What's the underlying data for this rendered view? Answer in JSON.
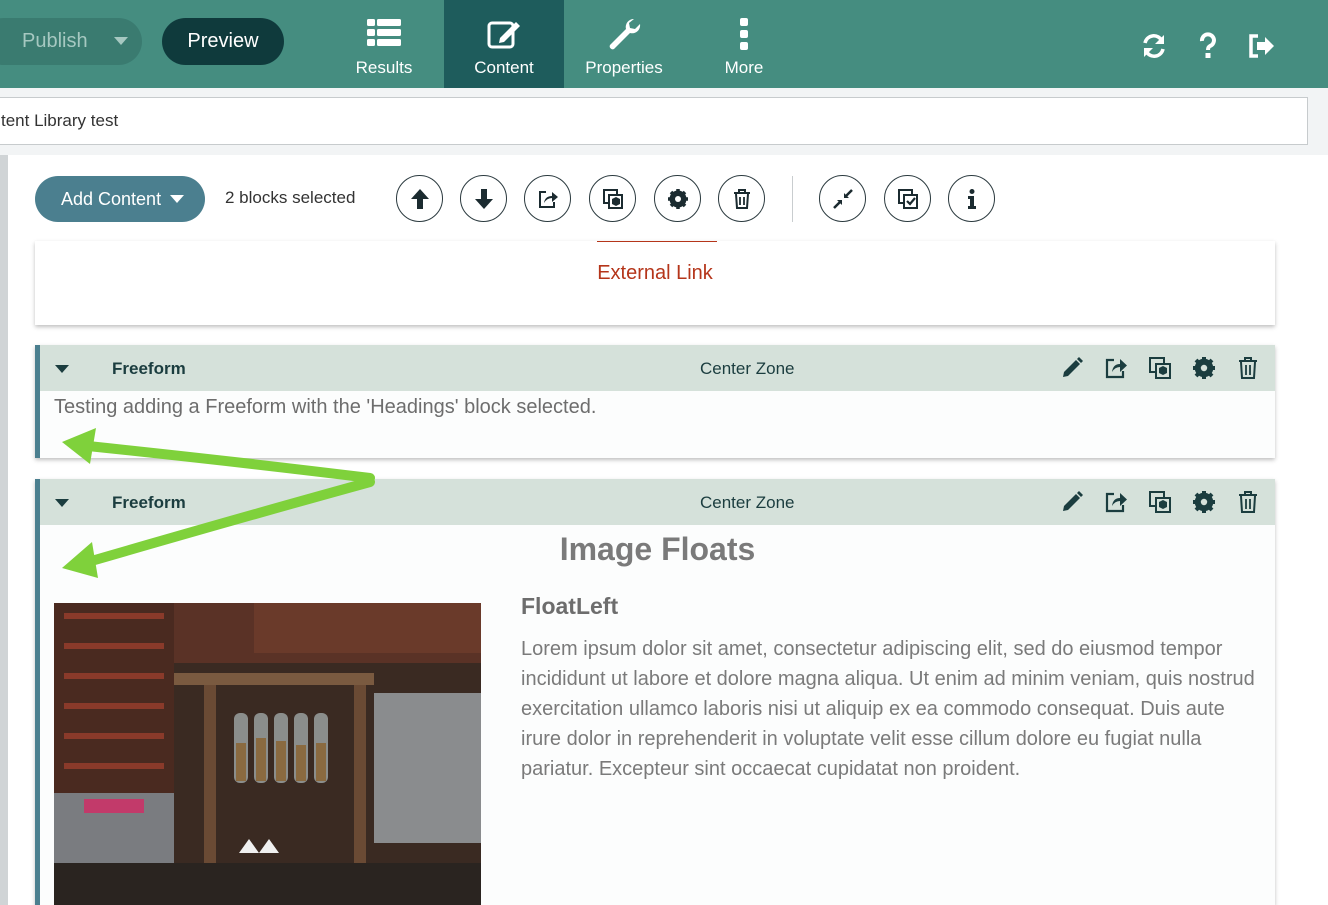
{
  "topbar": {
    "publish_label": "Publish",
    "preview_label": "Preview",
    "nav": [
      {
        "label": "Results",
        "icon": "list-icon"
      },
      {
        "label": "Content",
        "icon": "edit-icon"
      },
      {
        "label": "Properties",
        "icon": "wrench-icon"
      },
      {
        "label": "More",
        "icon": "more-vertical-icon"
      }
    ],
    "right_icons": [
      "refresh-icon",
      "help-icon",
      "sign-out-icon"
    ],
    "accent_color": "#458d80",
    "active_color": "#1e5c5c"
  },
  "title_field": {
    "value": "tent Library test"
  },
  "toolbar": {
    "add_content_label": "Add Content",
    "selection_status": "2 blocks selected",
    "tools": [
      "move-up-icon",
      "move-down-icon",
      "share-icon",
      "copy-icon",
      "settings-icon",
      "delete-icon",
      "collapse-icon",
      "select-all-icon",
      "info-icon"
    ]
  },
  "blocks": [
    {
      "link_text": "External Link"
    },
    {
      "type": "Freeform",
      "zone": "Center Zone",
      "text": "Testing adding a Freeform with the 'Headings' block selected."
    },
    {
      "type": "Freeform",
      "zone": "Center Zone",
      "title": "Image Floats",
      "subheading": "FloatLeft",
      "paragraph": "Lorem ipsum dolor sit amet, consectetur adipiscing elit, sed do eiusmod tempor incididunt ut labore et dolore magna aliqua. Ut enim ad minim veniam, quis nostrud exercitation ullamco laboris nisi ut aliquip ex ea commodo consequat. Duis aute irure dolor in reprehenderit in voluptate velit esse cillum dolore eu fugiat nulla pariatur. Excepteur sint occaecat cupidatat non proident."
    }
  ],
  "block_actions": [
    "edit-icon",
    "share-icon",
    "copy-icon",
    "settings-icon",
    "delete-icon"
  ],
  "annotation_color": "#7fd13b"
}
